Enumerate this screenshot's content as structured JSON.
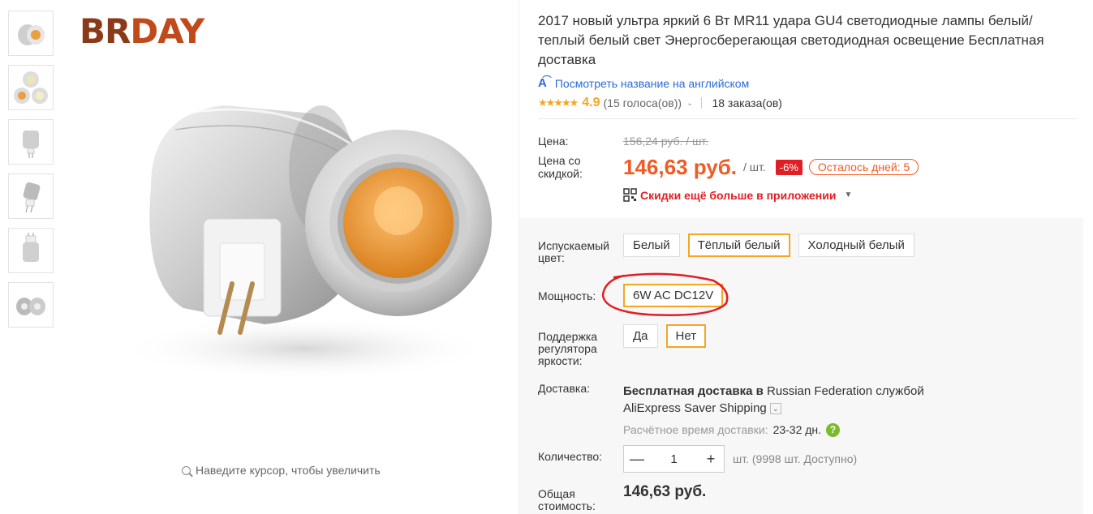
{
  "thumbnails": [
    {
      "name": "thumb-1"
    },
    {
      "name": "thumb-2"
    },
    {
      "name": "thumb-3"
    },
    {
      "name": "thumb-4"
    },
    {
      "name": "thumb-5"
    },
    {
      "name": "thumb-6"
    }
  ],
  "brand": {
    "part1": "BR",
    "part2": "DAY"
  },
  "zoom_hint": "Наведите курсор, чтобы увеличить",
  "product": {
    "title": "2017 новый ультра яркий 6 Вт MR11 удара GU4 светодиодные лампы белый/теплый белый свет Энергосберегающая светодиодная освещение Бесплатная доставка",
    "translate_link": "Посмотреть название на английском",
    "rating": {
      "stars": "★★★★★",
      "score": "4.9",
      "votes": "(15 голоса(ов))",
      "orders": "18 заказа(ов)"
    }
  },
  "price": {
    "old_label": "Цена:",
    "old_value": "156,24 руб. / шт.",
    "new_label_line1": "Цена со",
    "new_label_line2": "скидкой:",
    "new_value": "146,63 руб.",
    "per_unit": "/ шт.",
    "discount": "-6%",
    "days_left": "Осталось дней: 5",
    "app_promo": "Скидки ещё больше в приложении"
  },
  "options": {
    "color": {
      "label_line1": "Испускаемый",
      "label_line2": "цвет:",
      "values": [
        "Белый",
        "Тёплый белый",
        "Холодный белый"
      ],
      "selected_index": 1
    },
    "power": {
      "label": "Мощность:",
      "values": [
        "6W AC DC12V"
      ],
      "selected_index": 0
    },
    "dimmer": {
      "label_line1": "Поддержка",
      "label_line2": "регулятора",
      "label_line3": "яркости:",
      "values": [
        "Да",
        "Нет"
      ],
      "selected_index": 1
    }
  },
  "shipping": {
    "label": "Доставка:",
    "line_bold": "Бесплатная доставка в",
    "country": "Russian Federation",
    "by": "службой",
    "service": "AliExpress Saver Shipping",
    "eta_label": "Расчётное время доставки:",
    "eta_value": "23-32 дн."
  },
  "quantity": {
    "label": "Количество:",
    "value": "1",
    "minus": "—",
    "plus": "+",
    "stock": "шт. (9998 шт. Доступно)"
  },
  "total": {
    "label_line1": "Общая",
    "label_line2": "стоимость:",
    "value": "146,63 руб."
  },
  "colors": {
    "accent": "#f15a24",
    "selected_border": "#f5a623",
    "discount_bg": "#e01f24",
    "link": "#2a6bd8",
    "star": "#f5a623",
    "annotation": "#e01f24"
  }
}
